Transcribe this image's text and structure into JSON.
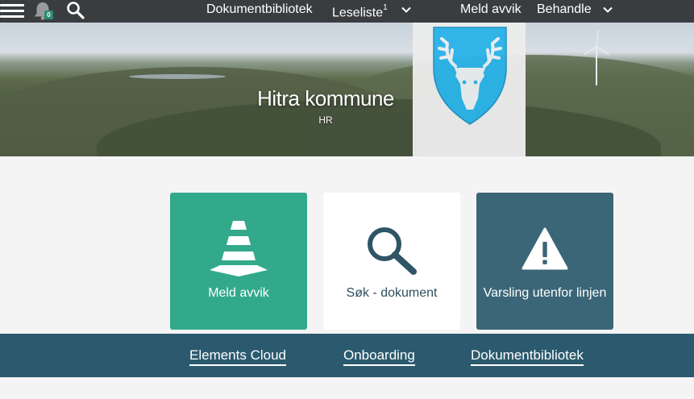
{
  "topbar": {
    "notifications_count": "0",
    "nav": {
      "dokumentbibliotek": "Dokumentbibliotek",
      "leseliste": "Leseliste",
      "leseliste_count": "1",
      "meld_avvik": "Meld avvik",
      "behandle": "Behandle"
    }
  },
  "hero": {
    "title": "Hitra kommune",
    "subtitle": "HR"
  },
  "tiles": [
    {
      "label": "Meld avvik",
      "icon": "traffic-cone-icon",
      "color": "#33a98c"
    },
    {
      "label": "Søk - dokument",
      "icon": "search-icon",
      "color": "#ffffff"
    },
    {
      "label": "Varsling utenfor linjen",
      "icon": "warning-icon",
      "color": "#3b6678"
    }
  ],
  "links": [
    {
      "label": "Elements Cloud"
    },
    {
      "label": "Onboarding"
    },
    {
      "label": "Dokumentbibliotek"
    }
  ],
  "colors": {
    "topbar": "#3a3d3f",
    "band": "#2b5a6e",
    "accent_green": "#33a98c",
    "crest_blue": "#2bb3e8"
  }
}
